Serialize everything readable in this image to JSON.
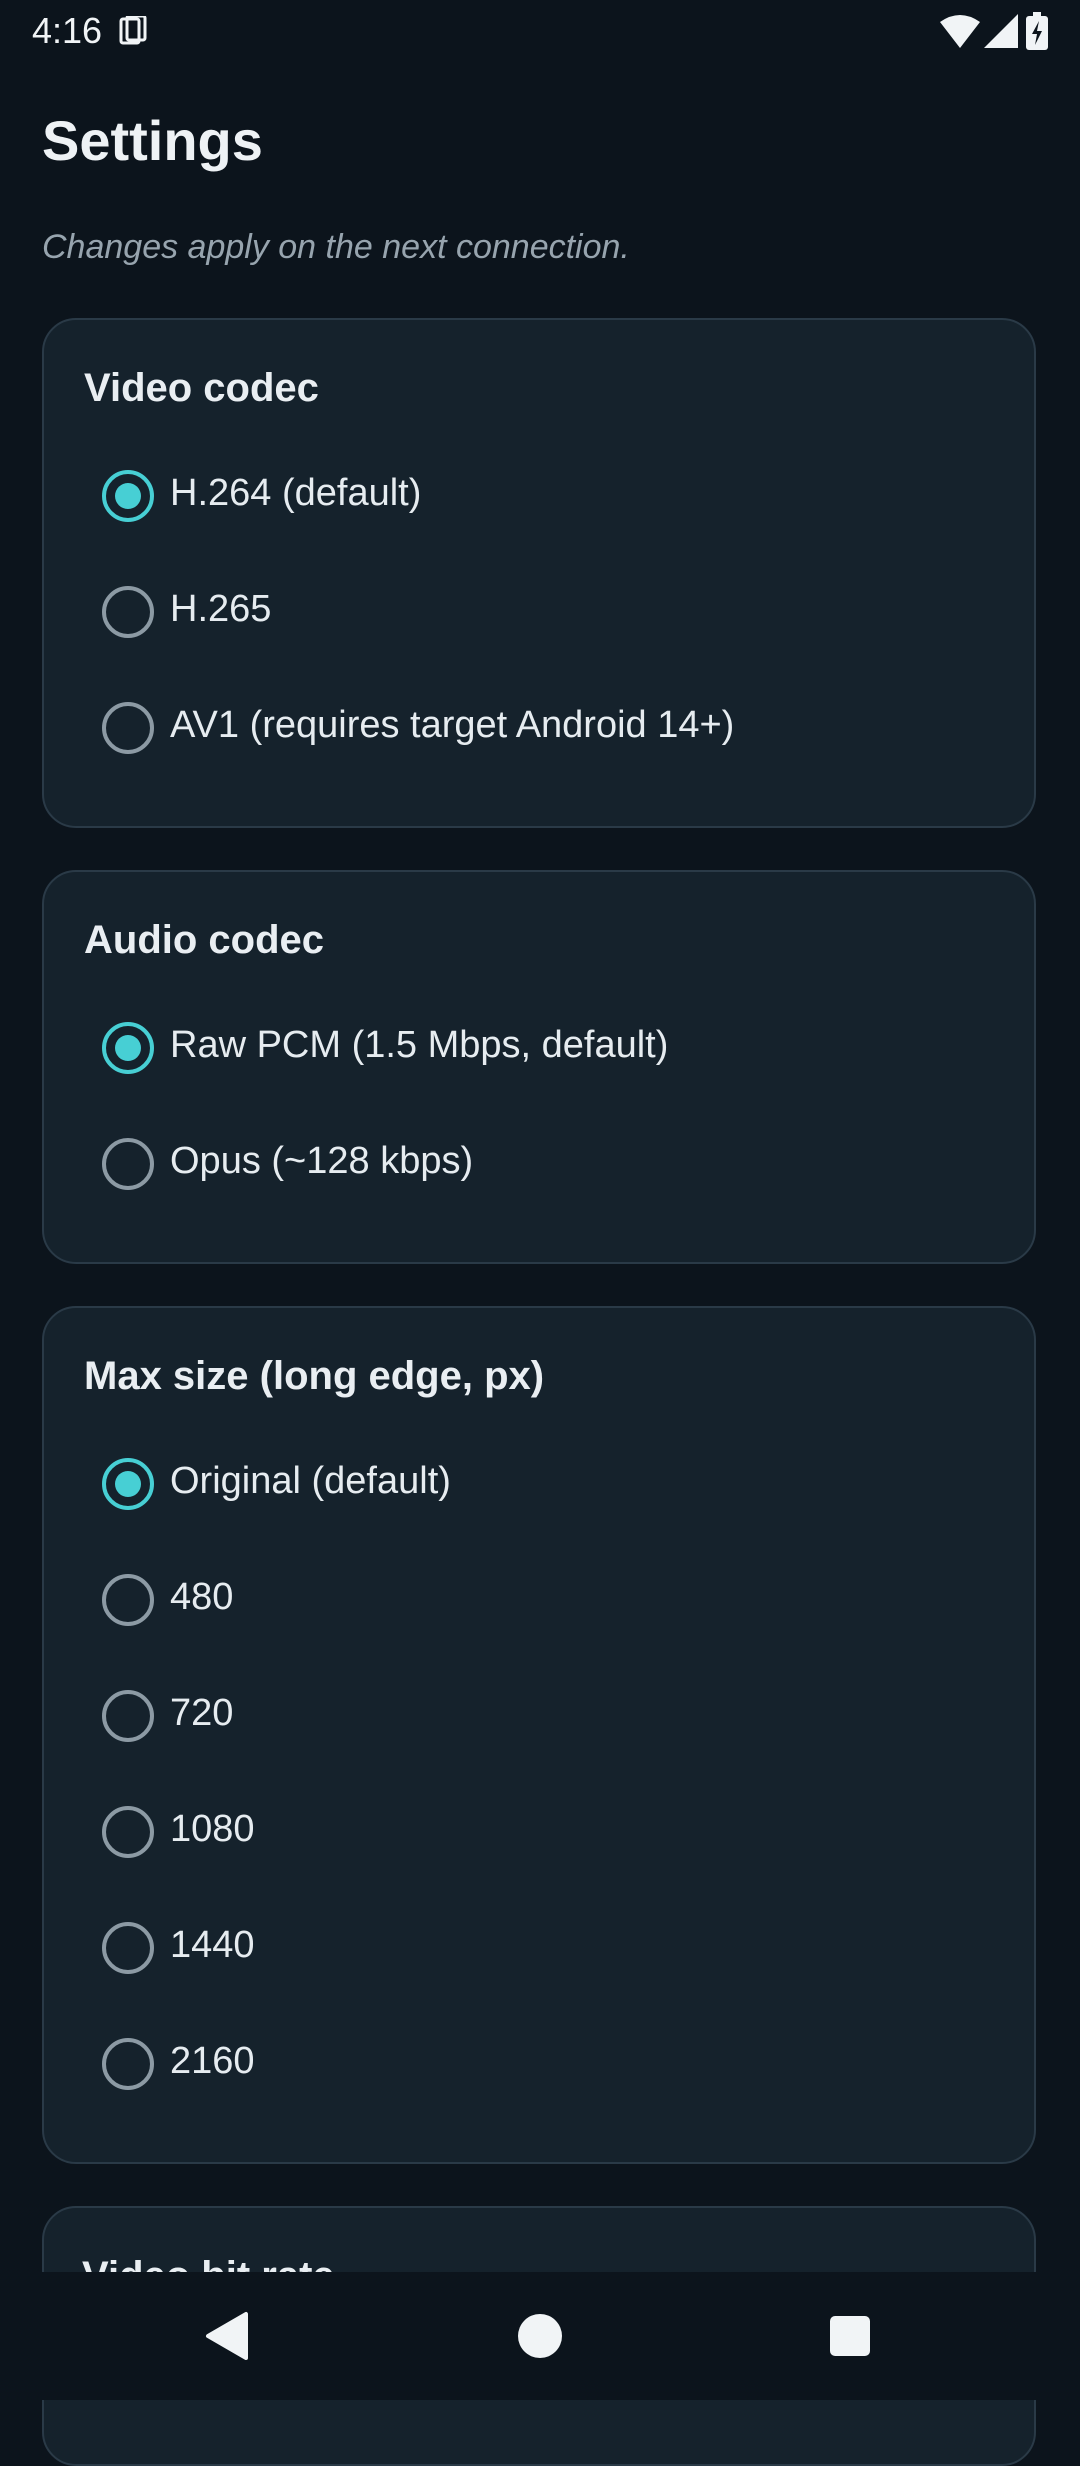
{
  "status_bar": {
    "time": "4:16",
    "icons": [
      "screen-icon",
      "wifi-icon",
      "signal-icon",
      "battery-charging-icon"
    ]
  },
  "page": {
    "title": "Settings",
    "subtitle": "Changes apply on the next connection."
  },
  "sections": {
    "video_codec": {
      "title": "Video codec",
      "options": [
        {
          "label": "H.264 (default)",
          "checked": true
        },
        {
          "label": "H.265",
          "checked": false
        },
        {
          "label": "AV1 (requires target Android 14+)",
          "checked": false
        }
      ]
    },
    "audio_codec": {
      "title": "Audio codec",
      "options": [
        {
          "label": "Raw PCM (1.5 Mbps, default)",
          "checked": true
        },
        {
          "label": "Opus (~128 kbps)",
          "checked": false
        }
      ]
    },
    "max_size": {
      "title": "Max size (long edge, px)",
      "options": [
        {
          "label": "Original (default)",
          "checked": true
        },
        {
          "label": "480",
          "checked": false
        },
        {
          "label": "720",
          "checked": false
        },
        {
          "label": "1080",
          "checked": false
        },
        {
          "label": "1440",
          "checked": false
        },
        {
          "label": "2160",
          "checked": false
        }
      ]
    },
    "video_bit_rate": {
      "title": "Video bit rate"
    }
  },
  "colors": {
    "accent": "#47cfd4",
    "background": "#0c141c",
    "card": "#15222c"
  },
  "nav_bar": {
    "icons": [
      "back-icon",
      "home-icon",
      "recents-icon"
    ]
  }
}
